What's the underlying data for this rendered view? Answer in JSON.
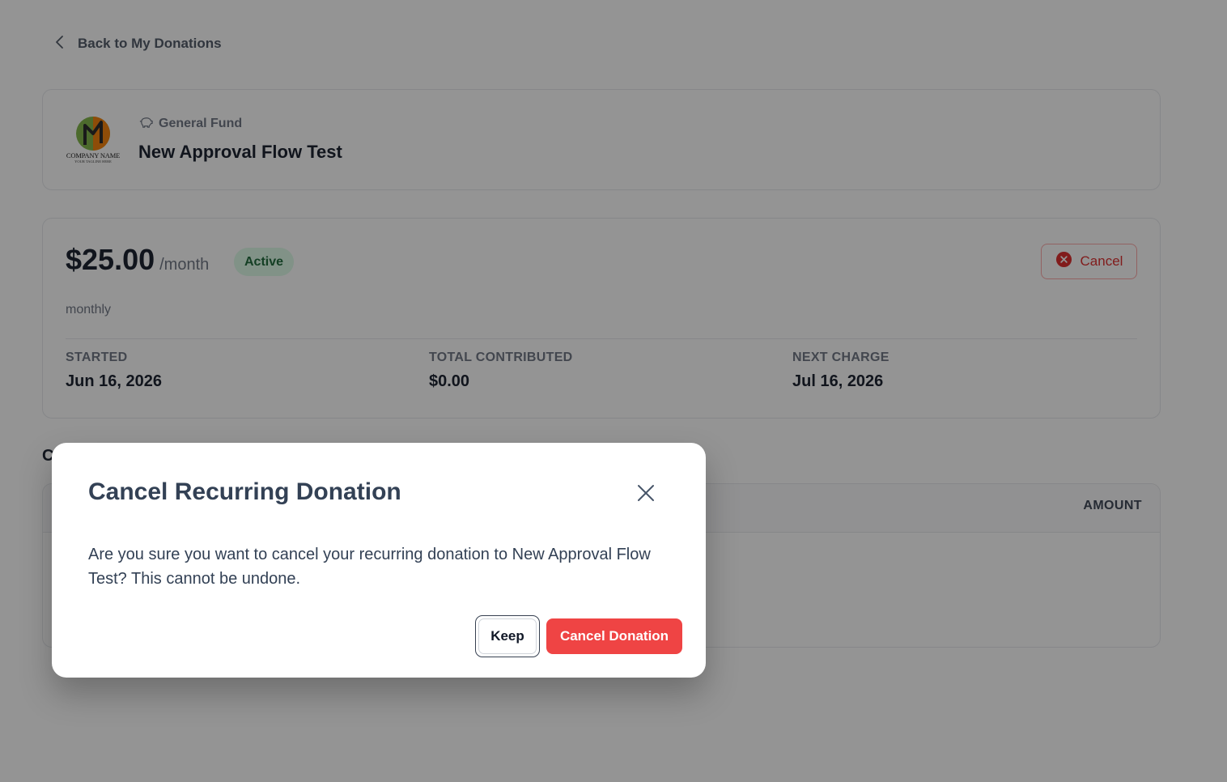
{
  "nav": {
    "back_label": "Back to My Donations"
  },
  "organization": {
    "logo_name": "COMPANY NAME",
    "logo_tagline": "YOUR TAGLINE HERE",
    "fund_name": "General Fund",
    "title": "New Approval Flow Test"
  },
  "donation": {
    "amount": "$25.00",
    "period": "/month",
    "status": "Active",
    "cancel_label": "Cancel",
    "frequency": "monthly",
    "stats": [
      {
        "label": "STARTED",
        "value": "Jun 16, 2026"
      },
      {
        "label": "TOTAL CONTRIBUTED",
        "value": "$0.00"
      },
      {
        "label": "NEXT CHARGE",
        "value": "Jul 16, 2026"
      }
    ]
  },
  "history": {
    "title_visible": "C",
    "amount_header": "AMOUNT"
  },
  "modal": {
    "title": "Cancel Recurring Donation",
    "body": "Are you sure you want to cancel your recurring donation to New Approval Flow Test? This cannot be undone.",
    "keep_label": "Keep",
    "confirm_label": "Cancel Donation"
  },
  "colors": {
    "danger": "#ef4444",
    "active_badge_bg": "#dcfce7",
    "active_badge_text": "#166534",
    "overlay": "rgba(17,17,17,0.45)"
  }
}
